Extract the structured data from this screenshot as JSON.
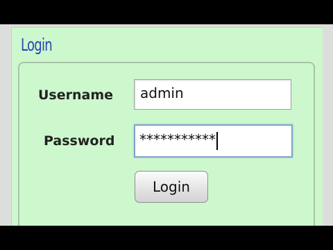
{
  "login_panel": {
    "title": "Login",
    "username": {
      "label": "Username",
      "value": "admin"
    },
    "password": {
      "label": "Password",
      "value": "***********"
    },
    "submit_label": "Login"
  },
  "colors": {
    "panel_background": "#cdf8cd",
    "title_color": "#2a45b8",
    "focus_border": "#7ea3c8"
  }
}
